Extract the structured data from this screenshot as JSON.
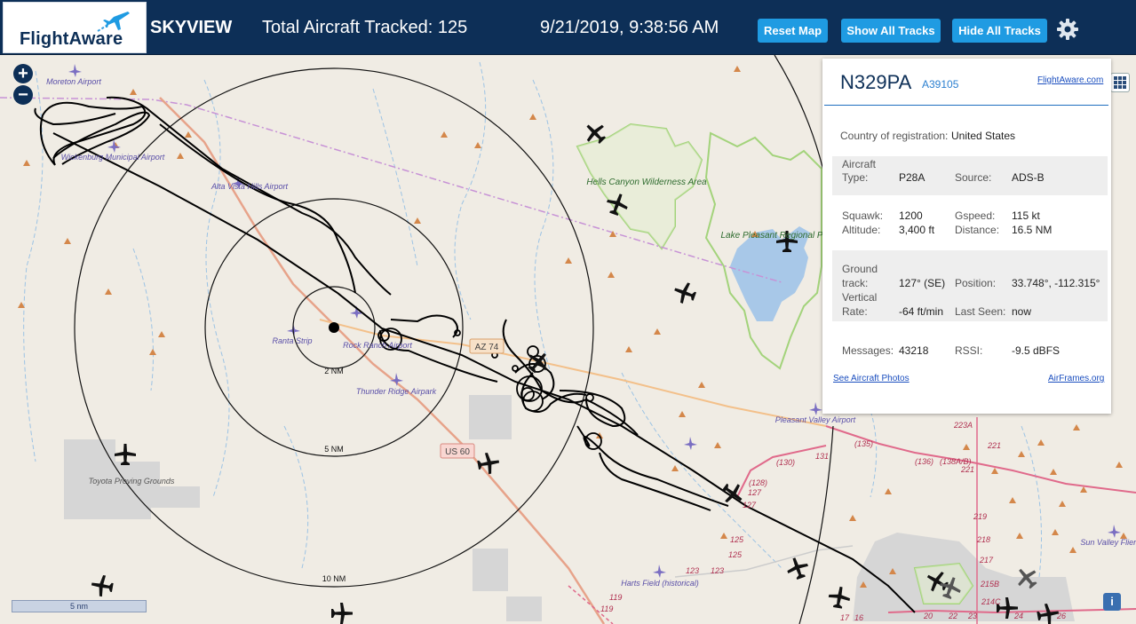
{
  "header": {
    "logo_text": "FlightAware",
    "app_name": "SKYVIEW",
    "tracked": "Total Aircraft Tracked: 125",
    "datetime": "9/21/2019, 9:38:56 AM",
    "buttons": {
      "reset": "Reset Map",
      "show": "Show All Tracks",
      "hide": "Hide All Tracks"
    },
    "settings_icon": "gear-icon"
  },
  "map": {
    "zoom_in": "+",
    "zoom_out": "−",
    "scale_label": "5 nm",
    "range_labels": [
      "2 NM",
      "5 NM",
      "10 NM"
    ],
    "places": [
      "Moreton Airport",
      "Wickenburg Municipal Airport",
      "Alta Vista Hills Airport",
      "Hells Canyon Wilderness Area",
      "Lake Pleasant Regional Park",
      "Ranta Strip",
      "Rock Ranch Airport",
      "Thunder Ridge Airpark",
      "Pleasant Valley Airport",
      "Toyota Proving Grounds",
      "Harts Field (historical)",
      "Sun Valley Fliers"
    ],
    "shields": [
      "AZ 74",
      "US 60"
    ],
    "road_numbers": [
      "(135)",
      "(130)",
      "131",
      "(128)",
      "127",
      "127",
      "125",
      "125",
      "123",
      "123",
      "119",
      "119",
      "(136)",
      "(138A/B)",
      "221",
      "223A",
      "219",
      "218",
      "217",
      "215B",
      "214C",
      "221",
      "17",
      "16",
      "20",
      "22",
      "23",
      "24",
      "26"
    ],
    "info_button": "i"
  },
  "panel": {
    "registration": "N329PA",
    "hex": "A39105",
    "fa_link": "FlightAware.com",
    "country_label": "Country of registration:",
    "country": "United States",
    "aircraft_type_label_1": "Aircraft",
    "aircraft_type_label_2": "Type:",
    "aircraft_type": "P28A",
    "source_label": "Source:",
    "source": "ADS-B",
    "squawk_label": "Squawk:",
    "squawk": "1200",
    "gspeed_label": "Gspeed:",
    "gspeed": "115 kt",
    "altitude_label": "Altitude:",
    "altitude": "3,400 ft",
    "distance_label": "Distance:",
    "distance": "16.5 NM",
    "ground_label_1": "Ground",
    "ground_label_2": "track:",
    "ground_track": "127° (SE)",
    "position_label": "Position:",
    "position": "33.748°, -112.315°",
    "vertical_label_1": "Vertical",
    "vertical_label_2": "Rate:",
    "vertical_rate": "-64 ft/min",
    "last_seen_label": "Last Seen:",
    "last_seen": "now",
    "messages_label": "Messages:",
    "messages": "43218",
    "rssi_label": "RSSI:",
    "rssi": "-9.5 dBFS",
    "photos_link": "See Aircraft Photos",
    "airframes_link": "AirFrames.org"
  }
}
